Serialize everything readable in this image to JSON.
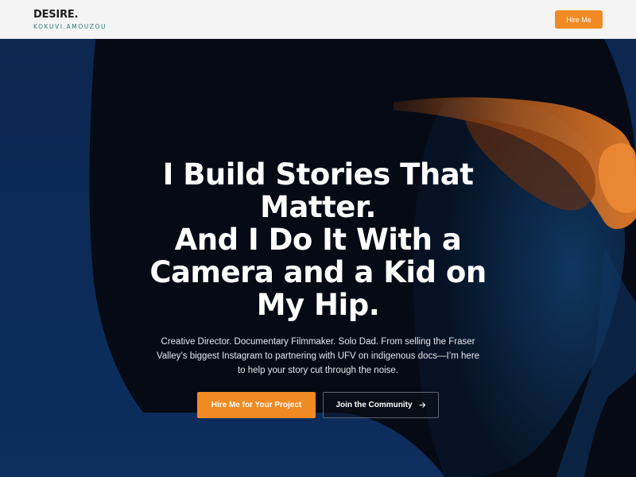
{
  "header": {
    "brand_name": "DESIRE.",
    "brand_sub": "KOKUVI.AMOUZOU",
    "hire_label": "Hire Me"
  },
  "hero": {
    "background_image": "woman-silhouette-with-orange-sunglasses",
    "headline_lines": [
      "I Build Stories That",
      "Matter.",
      "And I Do It With a",
      "Camera and a Kid on",
      "My Hip."
    ],
    "subtext": "Creative Director. Documentary Filmmaker. Solo Dad. From selling the Fraser Valley’s biggest Instagram to partnering with UFV on indigenous docs—I’m here to help your story cut through the noise.",
    "primary_cta": "Hire Me for Your Project",
    "secondary_cta": "Join the Community",
    "secondary_icon": "arrow-right-icon"
  },
  "colors": {
    "accent": "#f08a23",
    "brand_sub": "#2a7d6f",
    "hero_bg": "#0b2a57"
  }
}
